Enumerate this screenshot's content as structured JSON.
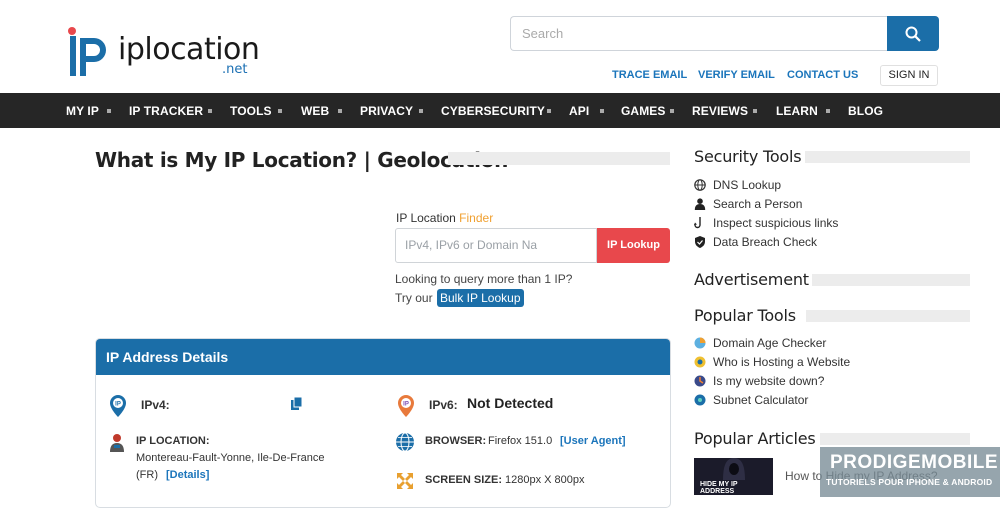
{
  "header": {
    "logo_word": "iplocation",
    "logo_suffix": ".net",
    "search_placeholder": "Search",
    "links": [
      "TRACE EMAIL",
      "VERIFY EMAIL",
      "CONTACT US"
    ],
    "signin": "SIGN IN"
  },
  "nav": [
    "MY IP",
    "IP TRACKER",
    "TOOLS",
    "WEB",
    "PRIVACY",
    "CYBERSECURITY",
    "API",
    "GAMES",
    "REVIEWS",
    "LEARN",
    "BLOG"
  ],
  "main": {
    "title": "What is My IP Location? | Geolocation",
    "finder_label_prefix": "IP Location ",
    "finder_label_accent": "Finder",
    "input_placeholder": "IPv4, IPv6 or Domain Na",
    "lookup_button": "IP Lookup",
    "query_text": "Looking to query more than 1 IP?",
    "try_text": "Try our",
    "bulk_link": "Bulk IP Lookup"
  },
  "card": {
    "title": "IP Address Details",
    "ipv4_label": "IPv4:",
    "ipv6_label": "IPv6:",
    "ipv6_value": "Not Detected",
    "location_label": "IP LOCATION:",
    "location_value": "Montereau-Fault-Yonne, Ile-De-France",
    "location_country": "(FR)",
    "details_link": "[Details]",
    "browser_label": "BROWSER:",
    "browser_value": "Firefox 151.0",
    "user_agent_link": "[User Agent]",
    "screen_label": "SCREEN SIZE:",
    "screen_value": "1280px X 800px"
  },
  "sidebar": {
    "security_title": "Security Tools",
    "security_items": [
      "DNS Lookup",
      "Search a Person",
      "Inspect suspicious links",
      "Data Breach Check"
    ],
    "ad_title": "Advertisement",
    "popular_tools_title": "Popular Tools",
    "popular_tools": [
      "Domain Age Checker",
      "Who is Hosting a Website",
      "Is my website down?",
      "Subnet Calculator"
    ],
    "popular_articles_title": "Popular Articles",
    "article_thumb_text": "HIDE MY IP ADDRESS",
    "article_text": "How to Hide my IP Address?"
  },
  "watermark": {
    "main": "PRODIGEMOBILE",
    "sub": "TUTORIELS POUR IPHONE & ANDROID"
  },
  "colors": {
    "brand_blue": "#1b6ea8",
    "nav_bg": "#262626",
    "lookup_red": "#e8484c",
    "accent_orange": "#f0a030"
  }
}
